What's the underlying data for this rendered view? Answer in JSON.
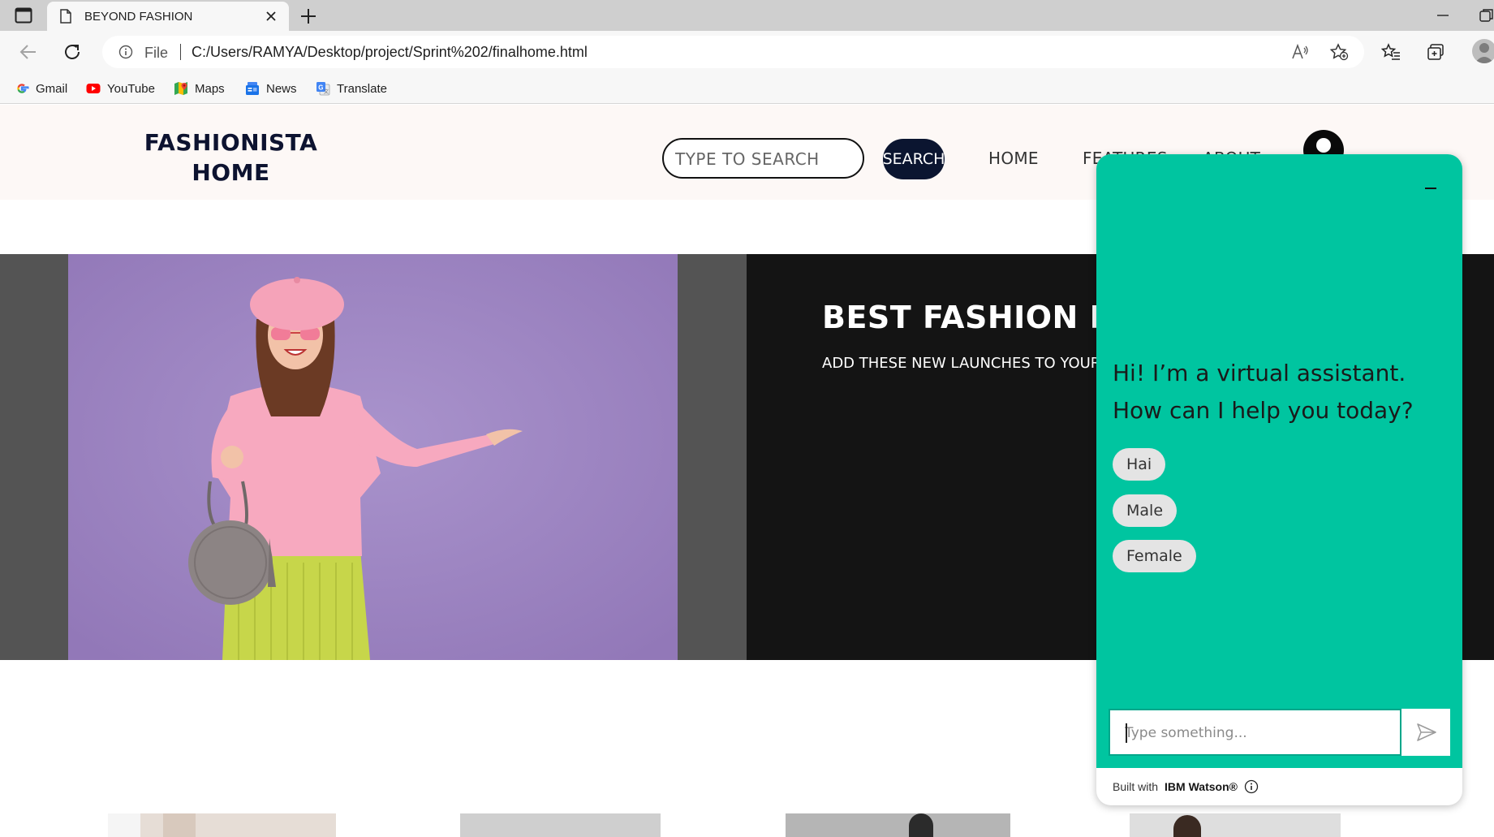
{
  "browser": {
    "tab_title": "BEYOND FASHION",
    "file_label": "File",
    "url": "C:/Users/RAMYA/Desktop/project/Sprint%202/finalhome.html",
    "bookmarks": [
      {
        "label": "Gmail",
        "icon": "google-icon"
      },
      {
        "label": "YouTube",
        "icon": "youtube-icon"
      },
      {
        "label": "Maps",
        "icon": "maps-icon"
      },
      {
        "label": "News",
        "icon": "news-icon"
      },
      {
        "label": "Translate",
        "icon": "translate-icon"
      }
    ]
  },
  "site": {
    "brand_line1": "FASHIONISTA",
    "brand_line2": "HOME",
    "search_placeholder": "TYPE TO SEARCH",
    "search_button": "SEARCH",
    "nav": {
      "home": "HOME",
      "features": "FEATURES",
      "about": "ABOUT"
    },
    "hero": {
      "title": "BEST FASHION FOR",
      "subtitle": "ADD THESE NEW LAUNCHES TO YOUR"
    }
  },
  "chat": {
    "message": "Hi! I’m a virtual assistant. How can I help you today?",
    "options": [
      "Hai",
      "Male",
      "Female"
    ],
    "input_placeholder": "Type something...",
    "footer_prefix": "Built with",
    "footer_brand": "IBM Watson®"
  },
  "colors": {
    "chat_accent": "#00c5a0",
    "nav_dark": "#0b1530",
    "hero_bg": "#141414",
    "photo_bg": "#9f86c4"
  }
}
